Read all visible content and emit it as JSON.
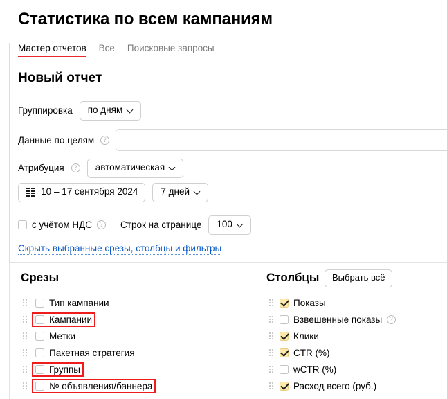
{
  "header": {
    "page_title": "Статистика по всем кампаниям",
    "tabs": [
      {
        "label": "Мастер отчетов",
        "active": true
      },
      {
        "label": "Все",
        "active": false
      },
      {
        "label": "Поисковые запросы",
        "active": false
      }
    ]
  },
  "report": {
    "title": "Новый отчет",
    "grouping": {
      "label": "Группировка",
      "value": "по дням"
    },
    "goals": {
      "label": "Данные по целям",
      "value": "—",
      "help": "?"
    },
    "attribution": {
      "label": "Атрибуция",
      "value": "автоматическая",
      "help": "?"
    },
    "date_range": {
      "value": "10 – 17 сентября 2024",
      "icon": "calendar-icon"
    },
    "period": {
      "value": "7 дней"
    },
    "vat": {
      "label": "с учётом НДС",
      "checked": false,
      "help": "?"
    },
    "rows_per_page": {
      "label": "Строк на странице",
      "value": "100"
    },
    "toggle_link": "Скрыть выбранные срезы, столбцы и фильтры"
  },
  "slices_panel": {
    "heading": "Срезы",
    "items": [
      {
        "label": "Тип кампании",
        "checked": false,
        "highlighted": false
      },
      {
        "label": "Кампании",
        "checked": false,
        "highlighted": true
      },
      {
        "label": "Метки",
        "checked": false,
        "highlighted": false
      },
      {
        "label": "Пакетная стратегия",
        "checked": false,
        "highlighted": false
      },
      {
        "label": "Группы",
        "checked": false,
        "highlighted": true
      },
      {
        "label": "№ объявления/баннера",
        "checked": false,
        "highlighted": true
      }
    ]
  },
  "columns_panel": {
    "heading": "Столбцы",
    "select_all_label": "Выбрать всё",
    "items": [
      {
        "label": "Показы",
        "checked": true,
        "help": false
      },
      {
        "label": "Взвешенные показы",
        "checked": false,
        "help": true
      },
      {
        "label": "Клики",
        "checked": true,
        "help": false
      },
      {
        "label": "CTR (%)",
        "checked": true,
        "help": false
      },
      {
        "label": "wCTR (%)",
        "checked": false,
        "help": false
      },
      {
        "label": "Расход всего (руб.)",
        "checked": true,
        "help": false
      }
    ]
  },
  "colors": {
    "accent_red": "#e8282b",
    "link_blue": "#0a5ac8",
    "highlight_red": "#ef1c1c",
    "checkbox_checked_bg": "#fde9a9"
  }
}
